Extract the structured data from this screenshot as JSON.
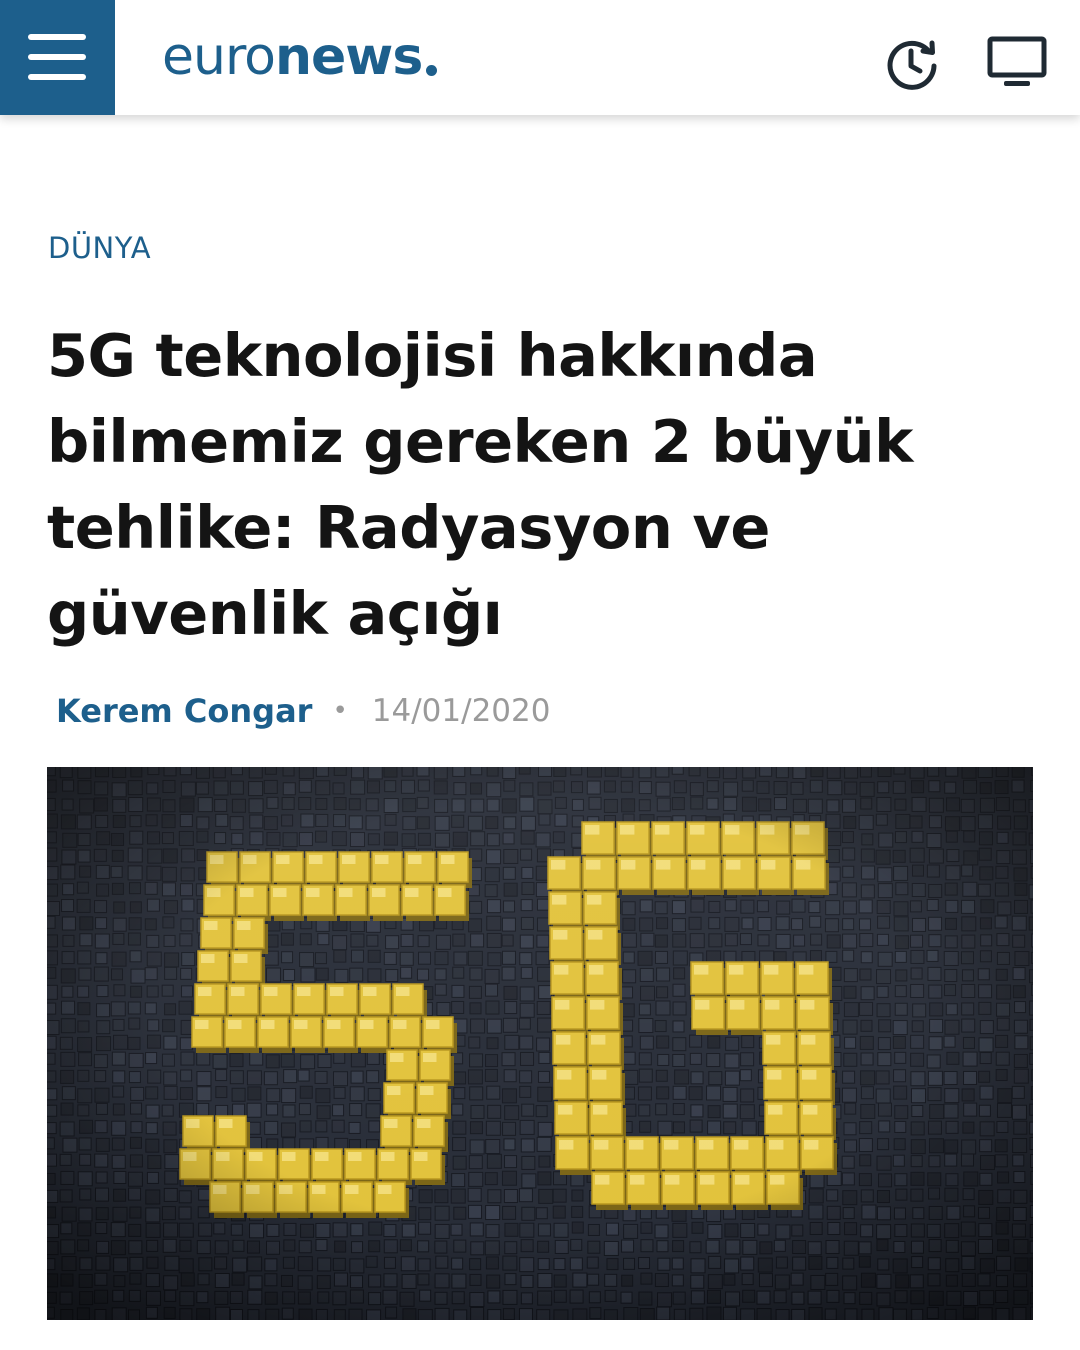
{
  "header": {
    "menu_icon": "hamburger-menu-icon",
    "logo": {
      "part1": "euro",
      "part2": "news"
    },
    "history_icon": "clock-history-icon",
    "tv_icon": "tv-monitor-icon",
    "brand_color": "#1d5f8c"
  },
  "article": {
    "category": "DÜNYA",
    "headline": "5G teknolojisi hakkında bilmemiz gereken 2 büyük tehlike: Radyasyon ve güvenlik açığı",
    "author": "Kerem Congar",
    "separator": "•",
    "date": "14/01/2020",
    "hero_image": {
      "text": "5G",
      "tile_color": "#2b303b",
      "accent_color": "#e2c23a"
    }
  }
}
